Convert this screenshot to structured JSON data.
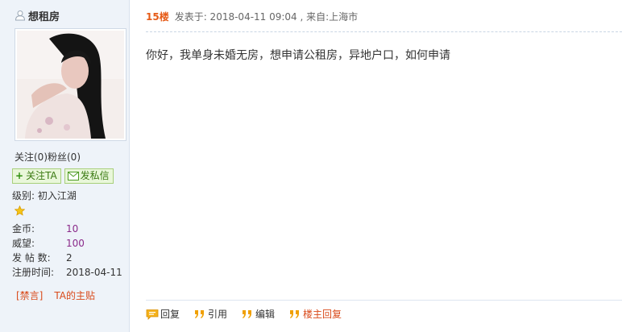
{
  "profile": {
    "username": "想租房",
    "follow_text": "关注(0)粉丝(0)",
    "follow_button": "关注TA",
    "message_button": "发私信",
    "level_label": "级别: 初入江湖",
    "stats": [
      {
        "key": "金币:",
        "value": "10",
        "highlight": true
      },
      {
        "key": "威望:",
        "value": "100",
        "highlight": true
      },
      {
        "key": "发 帖 数:",
        "value": "2",
        "highlight": false
      },
      {
        "key": "注册时间:",
        "value": "2018-04-11",
        "highlight": false
      }
    ],
    "ban_link": "[禁言]",
    "threads_link": "TA的主贴"
  },
  "post": {
    "floor": "15楼",
    "meta": "发表于: 2018-04-11 09:04 , 来自:上海市",
    "content": "你好，我单身未婚无房，想申请公租房，异地户口，如何申请"
  },
  "actions": {
    "reply": "回复",
    "quote": "引用",
    "edit": "编辑",
    "op_reply": "楼主回复"
  },
  "colors": {
    "floor": "#e65b17",
    "link_red": "#d94a1a",
    "stat_value": "#8a2a8a",
    "sidebar_bg": "#eef3f9"
  }
}
